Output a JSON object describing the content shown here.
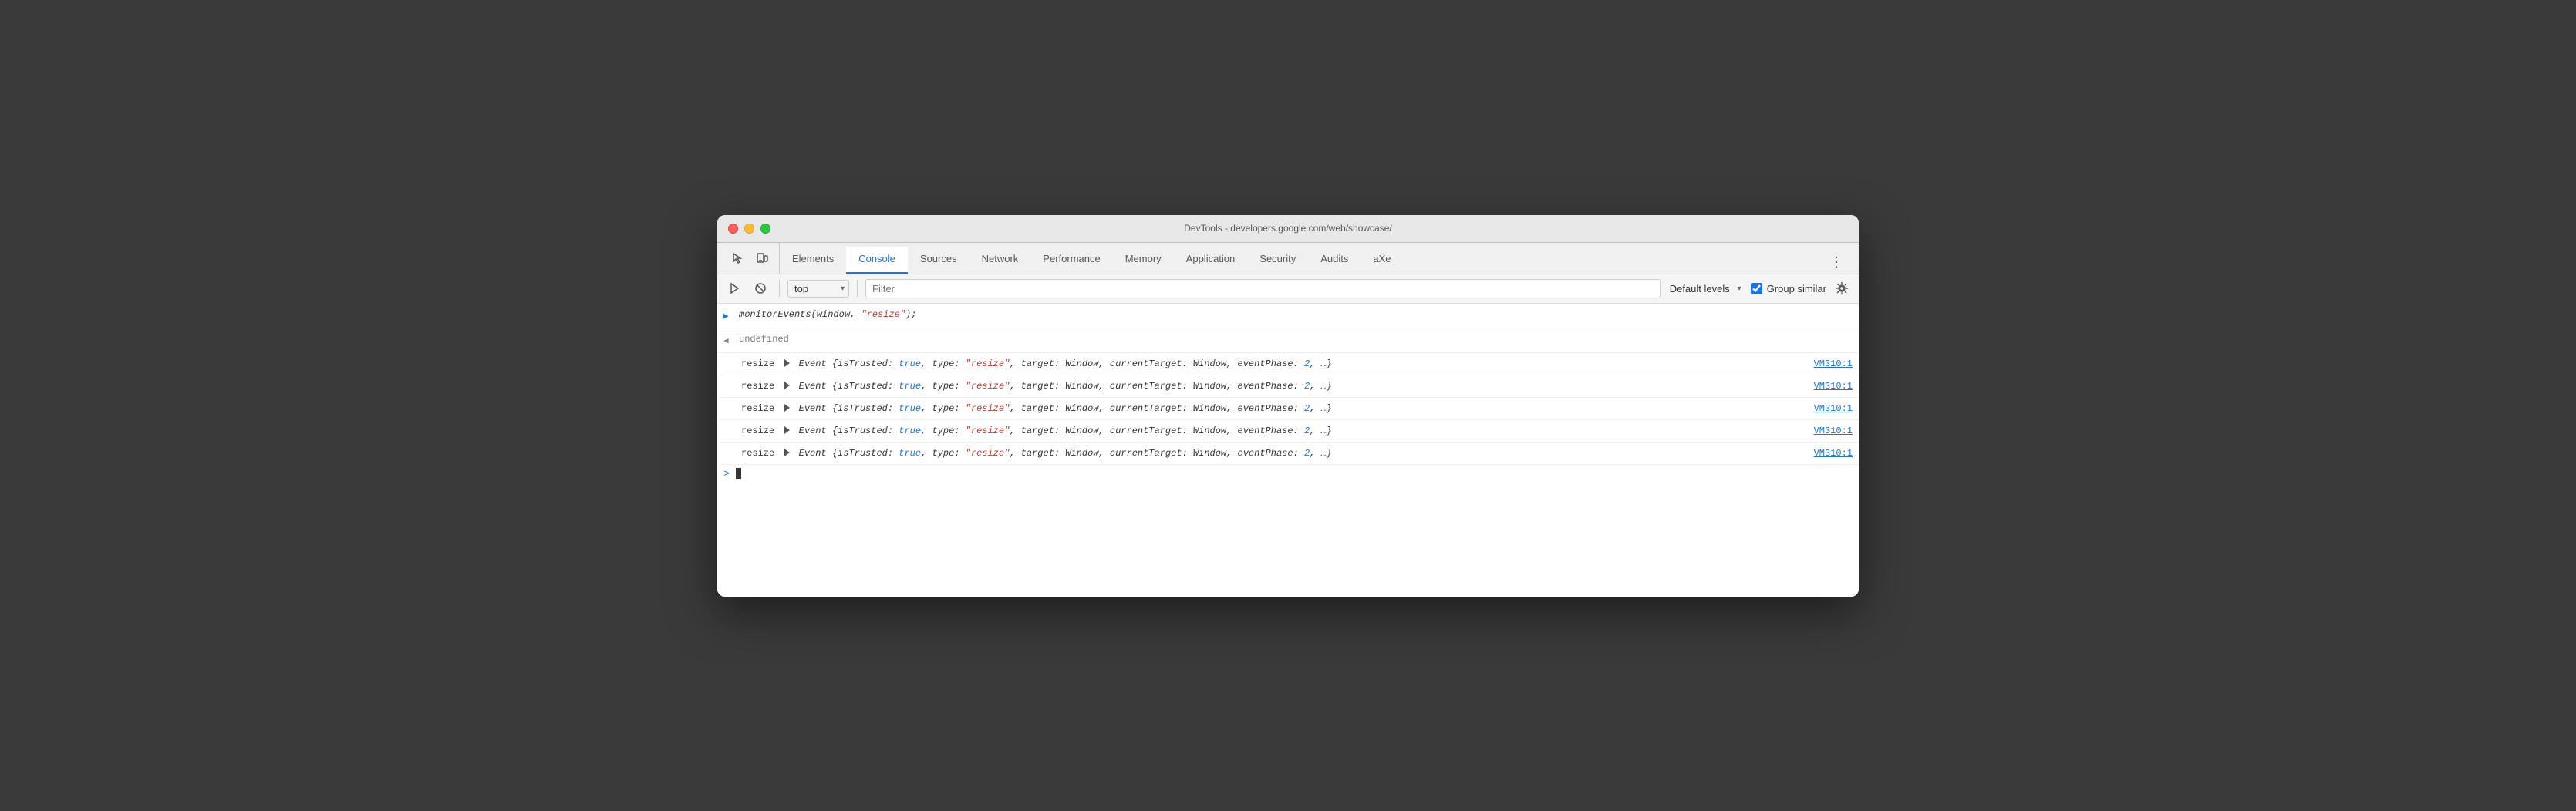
{
  "window": {
    "title": "DevTools - developers.google.com/web/showcase/"
  },
  "tabs": {
    "items": [
      {
        "id": "elements",
        "label": "Elements",
        "active": false
      },
      {
        "id": "console",
        "label": "Console",
        "active": true
      },
      {
        "id": "sources",
        "label": "Sources",
        "active": false
      },
      {
        "id": "network",
        "label": "Network",
        "active": false
      },
      {
        "id": "performance",
        "label": "Performance",
        "active": false
      },
      {
        "id": "memory",
        "label": "Memory",
        "active": false
      },
      {
        "id": "application",
        "label": "Application",
        "active": false
      },
      {
        "id": "security",
        "label": "Security",
        "active": false
      },
      {
        "id": "audits",
        "label": "Audits",
        "active": false
      },
      {
        "id": "axe",
        "label": "aXe",
        "active": false
      }
    ]
  },
  "toolbar": {
    "top_value": "top",
    "filter_placeholder": "Filter",
    "levels_label": "Default levels",
    "group_similar_label": "Group similar",
    "group_similar_checked": true
  },
  "console": {
    "input_command": "monitorEvents(window, \"resize\");",
    "output_undefined": "undefined",
    "event_rows": [
      {
        "label": "resize",
        "content": "Event {isTrusted: true, type: \"resize\", target: Window, currentTarget: Window, eventPhase: 2, …}",
        "source": "VM310:1"
      },
      {
        "label": "resize",
        "content": "Event {isTrusted: true, type: \"resize\", target: Window, currentTarget: Window, eventPhase: 2, …}",
        "source": "VM310:1"
      },
      {
        "label": "resize",
        "content": "Event {isTrusted: true, type: \"resize\", target: Window, currentTarget: Window, eventPhase: 2, …}",
        "source": "VM310:1"
      },
      {
        "label": "resize",
        "content": "Event {isTrusted: true, type: \"resize\", target: Window, currentTarget: Window, eventPhase: 2, …}",
        "source": "VM310:1"
      },
      {
        "label": "resize",
        "content": "Event {isTrusted: true, type: \"resize\", target: Window, currentTarget: Window, eventPhase: 2, …}",
        "source": "VM310:1"
      }
    ]
  }
}
